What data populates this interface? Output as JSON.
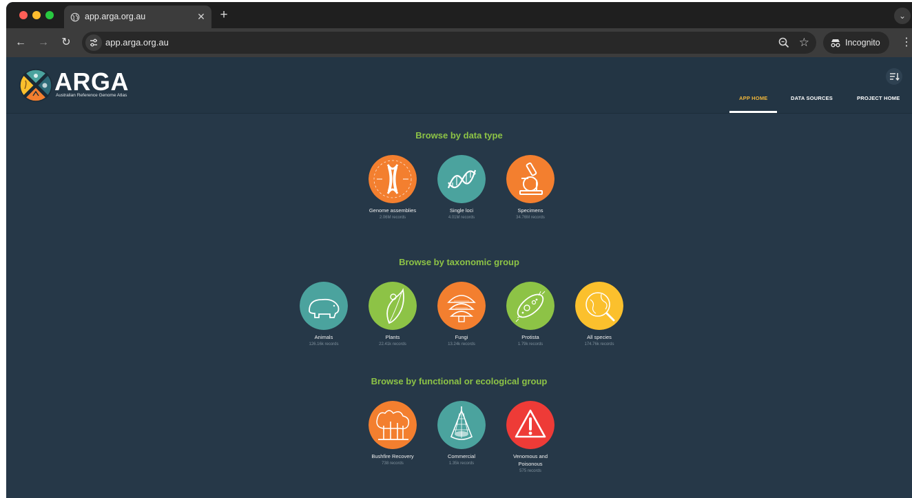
{
  "browser": {
    "tab_title": "app.arga.org.au",
    "url": "app.arga.org.au",
    "incognito_label": "Incognito",
    "new_tab_symbol": "+",
    "close_symbol": "✕"
  },
  "header": {
    "logo_text": "ARGA",
    "logo_subtitle": "Australian Reference Genome Atlas",
    "nav": [
      {
        "label": "APP HOME",
        "active": true
      },
      {
        "label": "DATA SOURCES",
        "active": false
      },
      {
        "label": "PROJECT HOME",
        "active": false
      }
    ]
  },
  "sections": [
    {
      "title": "Browse by data type",
      "items": [
        {
          "label": "Genome assemblies",
          "count": "2.06M records",
          "icon": "chromosome-icon",
          "color": "#f37f2f"
        },
        {
          "label": "Single loci",
          "count": "4.01M records",
          "icon": "dna-icon",
          "color": "#4ba39e"
        },
        {
          "label": "Specimens",
          "count": "34.76M records",
          "icon": "microscope-icon",
          "color": "#f37f2f"
        }
      ]
    },
    {
      "title": "Browse by taxonomic group",
      "items": [
        {
          "label": "Animals",
          "count": "126.16k records",
          "icon": "wombat-icon",
          "color": "#4ba39e"
        },
        {
          "label": "Plants",
          "count": "22.41k records",
          "icon": "leaf-icon",
          "color": "#8dc346"
        },
        {
          "label": "Fungi",
          "count": "13.24k records",
          "icon": "mushroom-icon",
          "color": "#f37f2f"
        },
        {
          "label": "Protista",
          "count": "1.79k records",
          "icon": "protist-icon",
          "color": "#8dc346"
        },
        {
          "label": "All species",
          "count": "174.76k records",
          "icon": "globe-search-icon",
          "color": "#fbc02d"
        }
      ]
    },
    {
      "title": "Browse by functional or ecological group",
      "items": [
        {
          "label": "Bushfire Recovery",
          "count": "738 records",
          "icon": "burnt-forest-icon",
          "color": "#f37f2f"
        },
        {
          "label": "Commercial",
          "count": "1.35k records",
          "icon": "fishing-net-icon",
          "color": "#4ba39e"
        },
        {
          "label": "Venomous and Poisonous",
          "count": "575 records",
          "icon": "warning-icon",
          "color": "#ee3b37"
        }
      ]
    }
  ]
}
